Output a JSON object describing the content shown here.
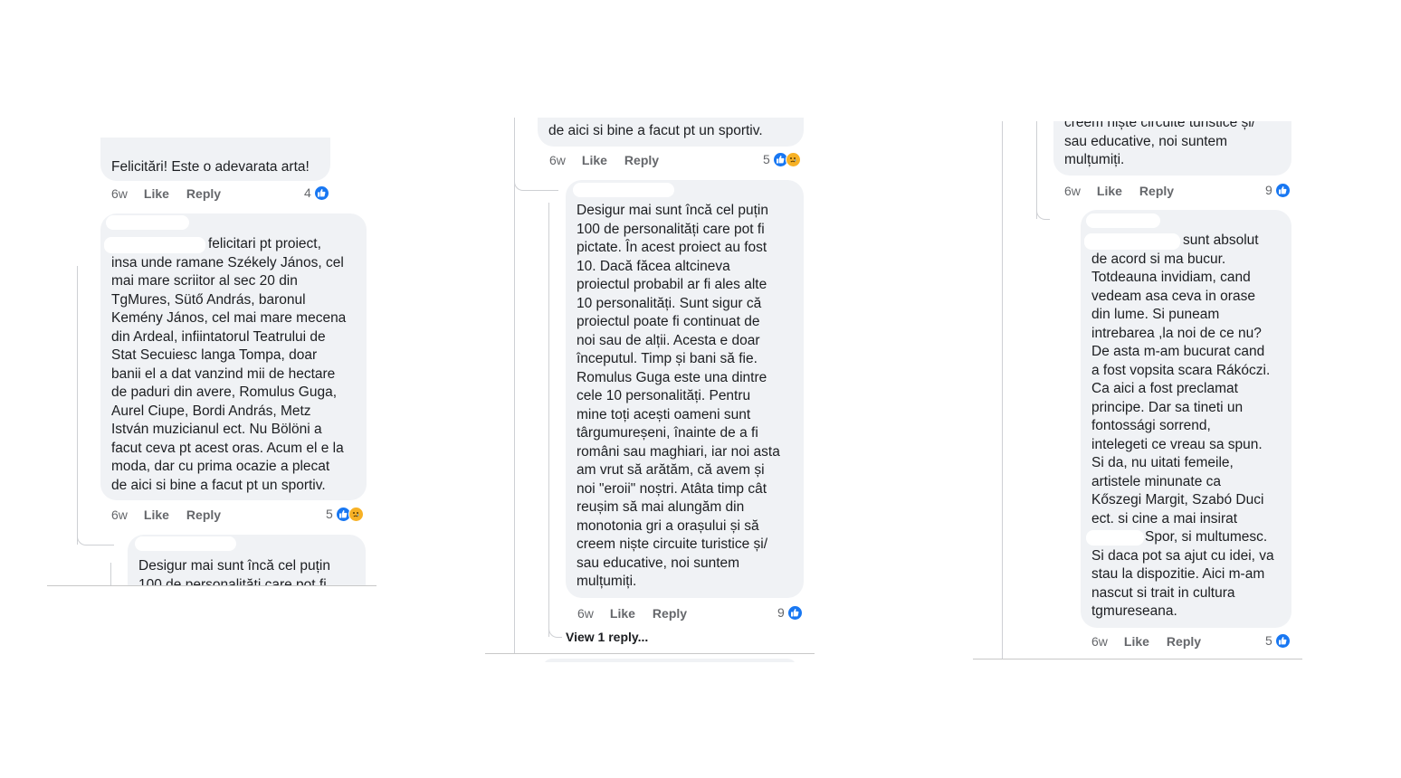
{
  "icons": {
    "like": "like-icon",
    "sad": "sad-icon"
  },
  "colors": {
    "like": "#1877f2",
    "sad": "#f7b125",
    "bubble": "#f0f2f5",
    "meta": "#65676b"
  },
  "left": {
    "c1": {
      "text": "Felicitări! Este o adevarata arta!",
      "time": "6w",
      "like": "Like",
      "reply": "Reply",
      "reactions": "4"
    },
    "c2": {
      "text": " felicitari pt proiect,\ninsa unde ramane Székely János, cel\nmai mare scriitor al sec 20 din\nTgMures, Sütő András, baronul\nKemény János, cel mai mare mecena\ndin Ardeal, infiintatorul Teatrului de\nStat Secuiesc langa Tompa, doar\nbanii el a dat vanzind mii de hectare\nde paduri din avere, Romulus Guga,\nAurel Ciupe, Bordi András, Metz\nIstván muzicianul ect. Nu Bölöni a\nfacut ceva pt acest oras. Acum el e la\nmoda, dar cu prima ocazie a plecat\nde aici si bine a facut pt un sportiv.",
      "time": "6w",
      "like": "Like",
      "reply": "Reply",
      "reactions": "5"
    },
    "c3": {
      "text": "Desigur mai sunt încă cel puțin\n100 de personalități care pot fi"
    }
  },
  "middle": {
    "c1": {
      "text": "de aici si bine a facut pt un sportiv.",
      "time": "6w",
      "like": "Like",
      "reply": "Reply",
      "reactions": "5"
    },
    "c2": {
      "text": "Desigur mai sunt încă cel puțin\n100 de personalități care pot fi\npictate. În acest proiect au fost\n10. Dacă făcea altcineva\nproiectul probabil ar fi ales alte\n10 personalități. Sunt sigur că\nproiectul poate fi continuat de\nnoi sau de alții. Acesta e doar\nînceputul. Timp și bani să fie.\nRomulus Guga este una dintre\ncele 10 personalități. Pentru\nmine toți acești oameni sunt\ntârgumureșeni, înainte de a fi\nromâni sau maghiari, iar noi asta\nam vrut să arătăm, că avem și\nnoi \"eroii\" noștri. Atâta timp cât\nreușim să mai alungăm din\nmonotonia gri a orașului și să\ncreem niște circuite turistice și/\nsau educative, noi suntem\nmulțumiți.",
      "time": "6w",
      "like": "Like",
      "reply": "Reply",
      "reactions": "9"
    },
    "view_replies": "View 1 reply..."
  },
  "right": {
    "c1": {
      "text": "creem niște circuite turistice și/\nsau educative, noi suntem\nmulțumiți.",
      "time": "6w",
      "like": "Like",
      "reply": "Reply",
      "reactions": "9"
    },
    "c2": {
      "first": "sunt absolut",
      "text": "de acord si ma bucur.\nTotdeauna invidiam, cand\nvedeam asa ceva in orase\ndin lume. Si puneam\nintrebarea ,la noi de ce nu?\nDe  asta m-am bucurat cand\na fost vopsita scara Rákóczi.\nCa aici a fost preclamat\nprincipe. Dar sa tineti un\nfontossági sorrend,\nintelegeti ce vreau sa spun.\nSi da, nu uitati femeile,\nartistele minunate ca\nKőszegi Margit, Szabó Duci\nect. si cine a mai insirat",
      "spor": "Spor, si multumesc.",
      "text2": "Si daca pot sa ajut cu idei, va\nstau la dispozitie. Aici m-am\nnascut si trait in cultura\ntgmureseana.",
      "time": "6w",
      "like": "Like",
      "reply": "Reply",
      "reactions": "5"
    }
  }
}
